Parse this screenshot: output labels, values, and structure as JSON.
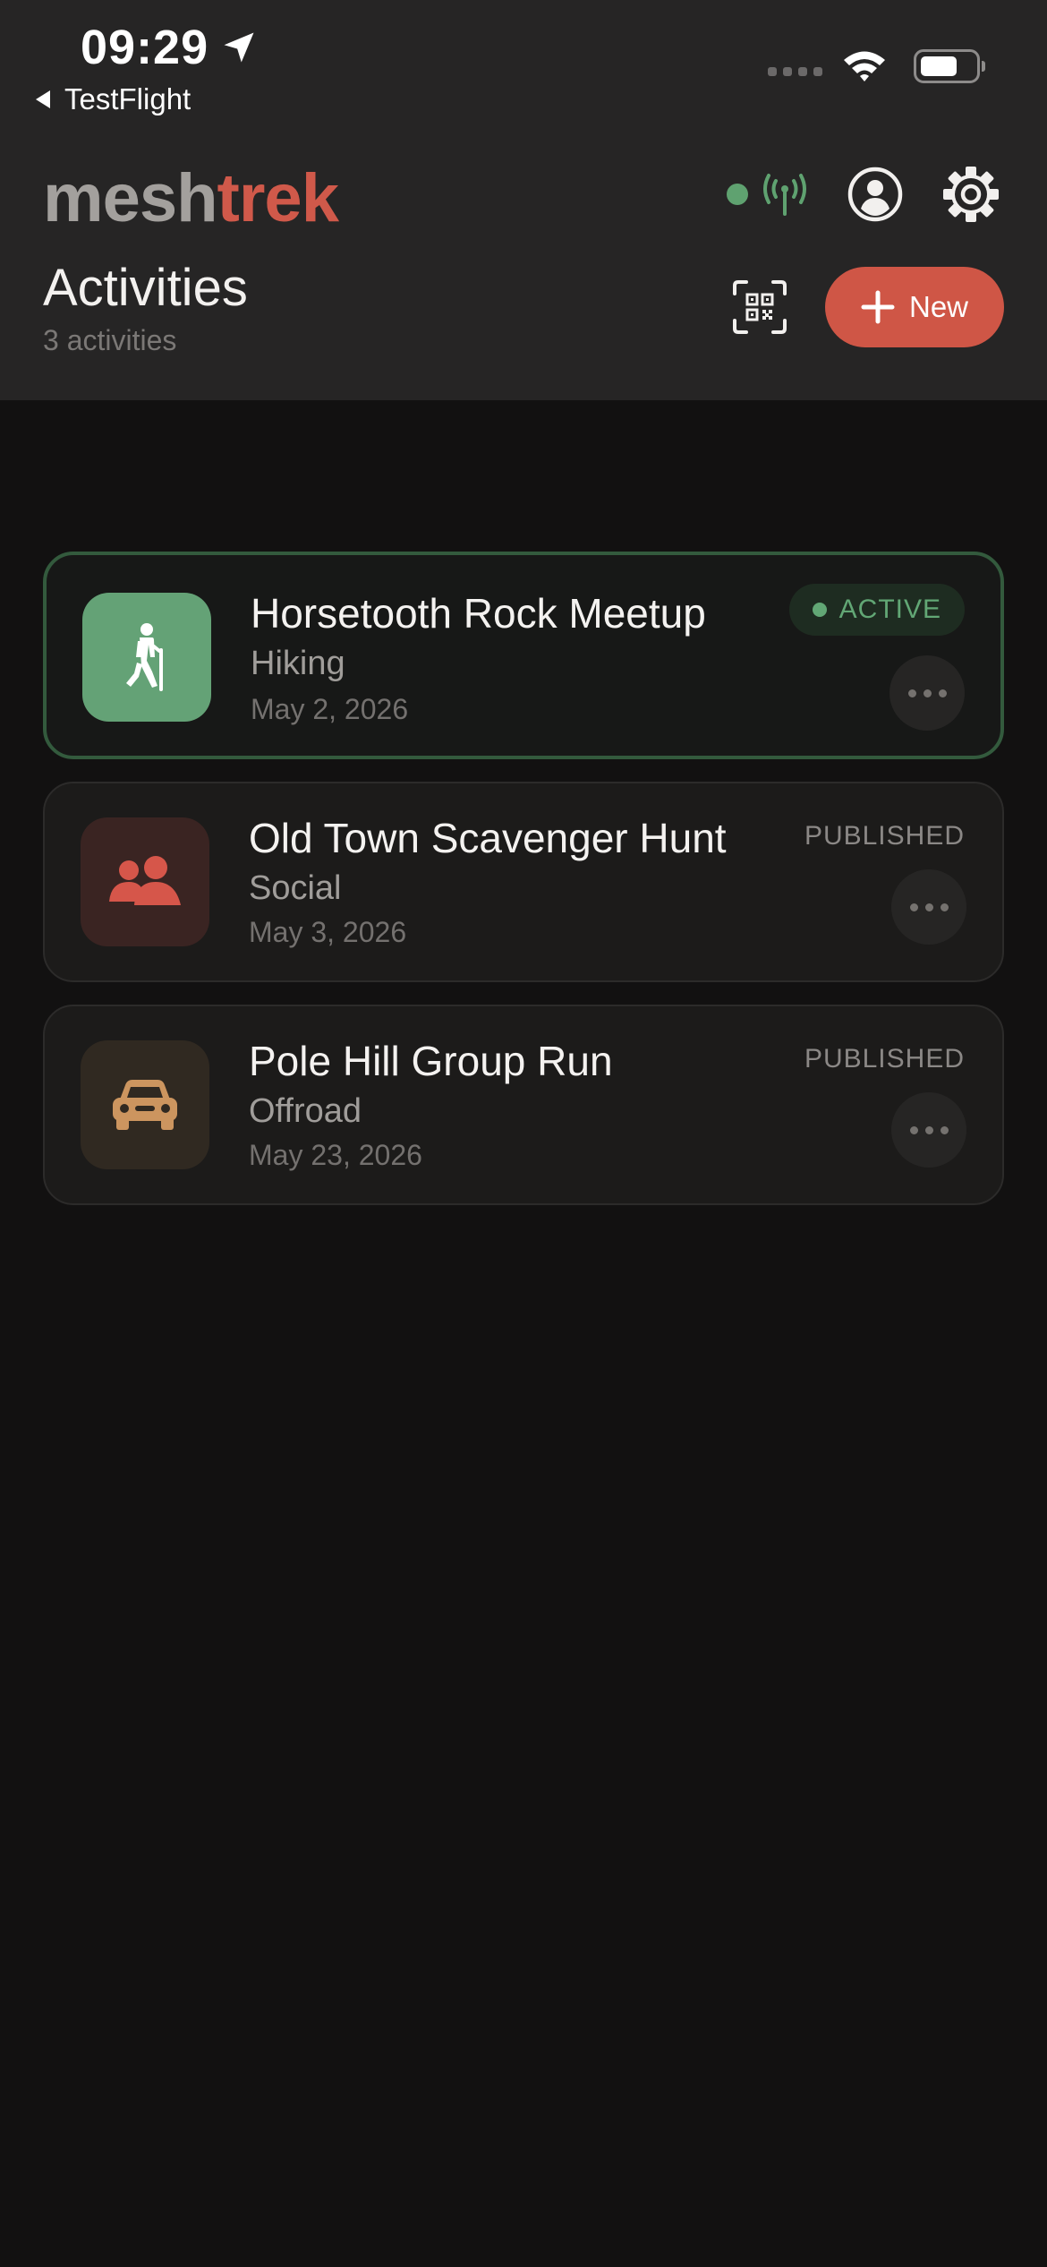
{
  "status_bar": {
    "time": "09:29",
    "back_label": "TestFlight"
  },
  "header": {
    "logo_part1": "mesh",
    "logo_part2": "trek",
    "title": "Activities",
    "subtitle": "3 activities",
    "new_button_label": "New",
    "connection_status_color": "#5fa270",
    "accent_color": "#cf5646"
  },
  "activities": [
    {
      "title": "Horsetooth Rock Meetup",
      "category": "Hiking",
      "date": "May 2, 2026",
      "status": "ACTIVE",
      "icon": "hiking-icon",
      "tile_color": "#64a276"
    },
    {
      "title": "Old Town Scavenger Hunt",
      "category": "Social",
      "date": "May 3, 2026",
      "status": "PUBLISHED",
      "icon": "people-icon",
      "tile_color": "#3a2422"
    },
    {
      "title": "Pole Hill Group Run",
      "category": "Offroad",
      "date": "May 23, 2026",
      "status": "PUBLISHED",
      "icon": "car-icon",
      "tile_color": "#302921"
    }
  ]
}
